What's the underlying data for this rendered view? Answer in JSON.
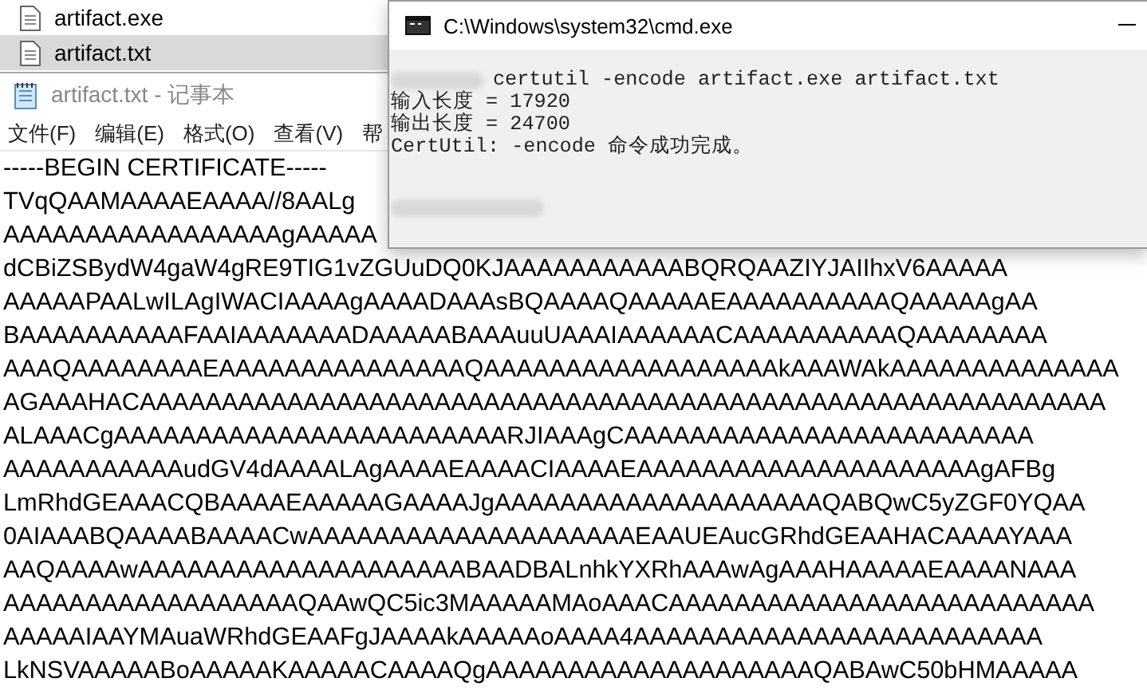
{
  "explorer": {
    "files": [
      {
        "name": "artifact.exe",
        "selected": false
      },
      {
        "name": "artifact.txt",
        "selected": true
      }
    ]
  },
  "notepad": {
    "title": "artifact.txt - 记事本",
    "menu": [
      "文件(F)",
      "编辑(E)",
      "格式(O)",
      "查看(V)",
      "帮"
    ],
    "lines": [
      "-----BEGIN CERTIFICATE-----",
      "TVqQAAMAAAAEAAAA//8AALg",
      "AAAAAAAAAAAAAAAAAgAAAAA",
      "dCBiZSBydW4gaW4gRE9TIG1vZGUuDQ0KJAAAAAAAAAAABQRQAAZIYJAIIhxV6AAAAA",
      "AAAAAPAALwILAgIWACIAAAAgAAAADAAAsBQAAAAQAAAAAEAAAAAAAAAAQAAAAAgAA",
      "BAAAAAAAAAAFAAIAAAAAAADAAAAABAAAuuUAAAIAAAAAACAAAAAAAAAAQAAAAAAAA",
      "AAAQAAAAAAAAEAAAAAAAAAAAAAAAQAAAAAAAAAAAAAAAAAAkAAAWAkAAAAAAAAAAAAAA",
      "AGAAAHACAAAAAAAAAAAAAAAAAAAAAAAAAAAAAAAAAAAAAAAAAAAAAAAAAAAAAAAAAAA",
      "ALAAACgAAAAAAAAAAAAAAAAAAAAAAAARJIAAAgCAAAAAAAAAAAAAAAAAAAAAAAAA",
      "AAAAAAAAAAAudGV4dAAAALAgAAAAEAAAACIAAAAEAAAAAAAAAAAAAAAAAAAAAgAFBg",
      "LmRhdGEAAACQBAAAAEAAAAAGAAAAJgAAAAAAAAAAAAAAAAAAAAQABQwC5yZGF0YQAA",
      "0AIAAABQAAAABAAAACwAAAAAAAAAAAAAAAAAAAAEAAUEAucGRhdGEAAHACAAAAYAAA",
      "AAQAAAAwAAAAAAAAAAAAAAAAAAAABAADBALnhkYXRhAAAwAgAAAHAAAAAEAAAANAAA",
      "AAAAAAAAAAAAAAAAAAQAAwQC5ic3MAAAAAMAoAAACAAAAAAAAAAAAAAAAAAAAAAAAAA",
      "AAAAAIAAYMAuaWRhdGEAAFgJAAAAkAAAAAoAAAA4AAAAAAAAAAAAAAAAAAAAAAAAA",
      "LkNSVAAAAABoAAAAAKAAAAACAAAAQgAAAAAAAAAAAAAAAAAAAAQABAwC50bHMAAAAA"
    ]
  },
  "cmd": {
    "title": "C:\\Windows\\system32\\cmd.exe",
    "lines": [
      {
        "kind": "command",
        "text": "certutil -encode artifact.exe artifact.txt"
      },
      {
        "kind": "output",
        "text": "输入长度 = 17920"
      },
      {
        "kind": "output",
        "text": "输出长度 = 24700"
      },
      {
        "kind": "output",
        "text": "CertUtil: -encode 命令成功完成。"
      },
      {
        "kind": "blank"
      },
      {
        "kind": "redacted"
      }
    ]
  }
}
